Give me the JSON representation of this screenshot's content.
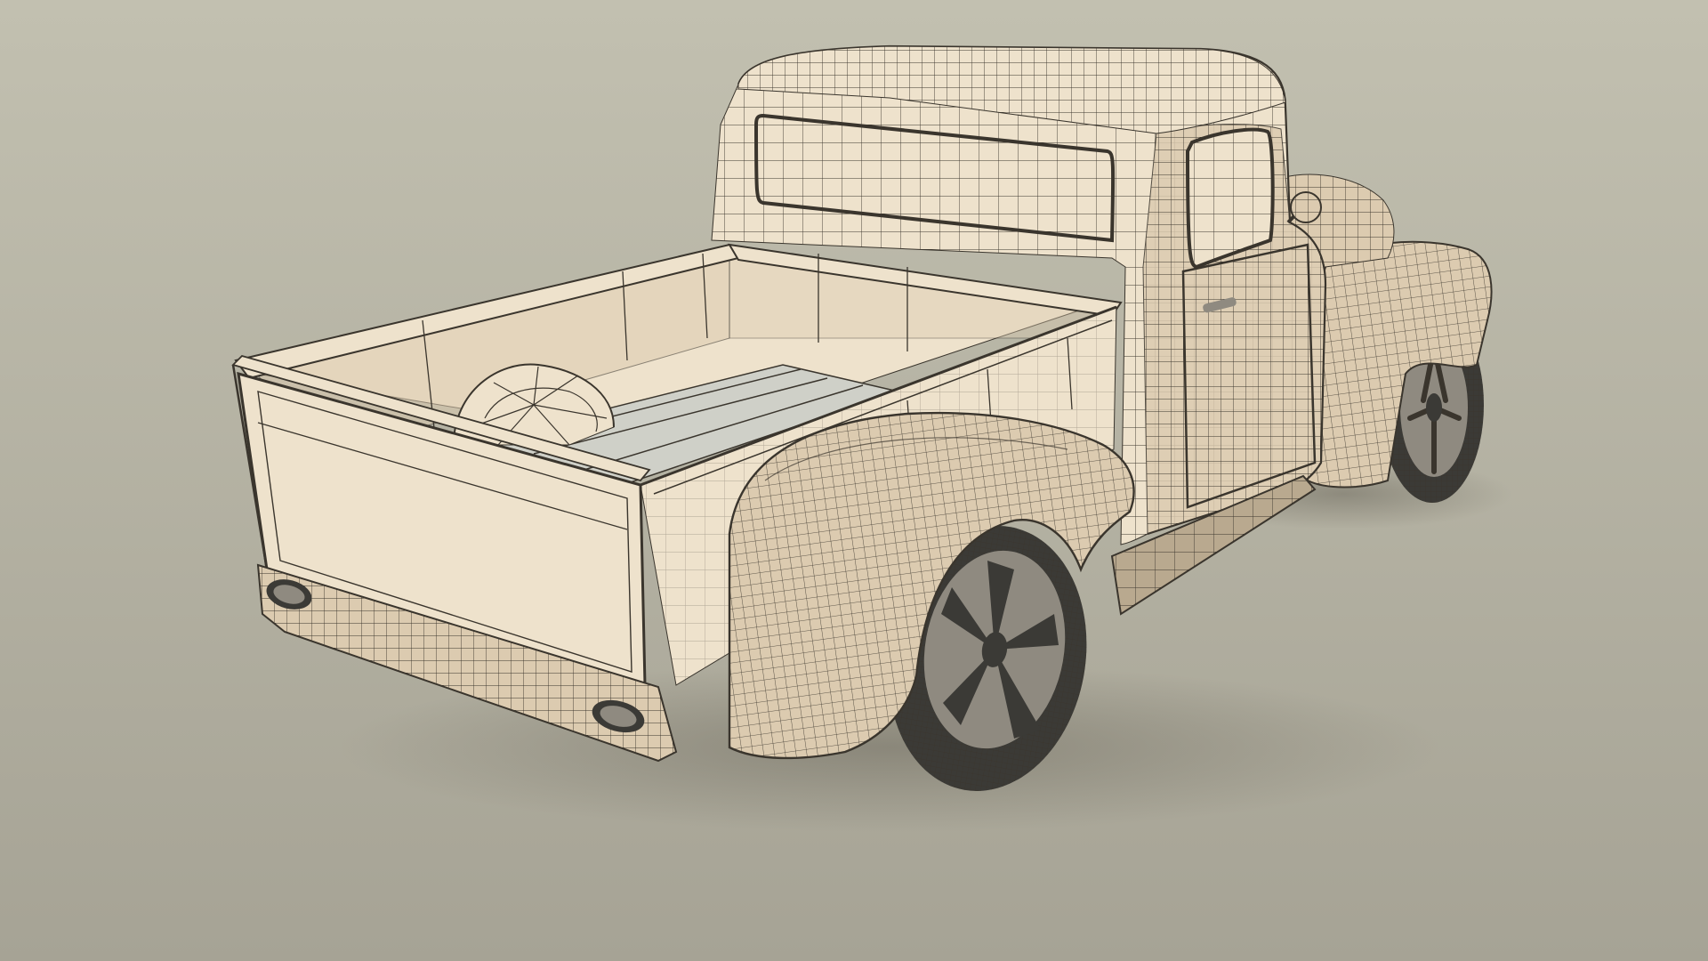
{
  "scene": {
    "subject": "pickup-truck-wireframe-render",
    "colors": {
      "background_top": "#c2c0b0",
      "background_bottom": "#a6a395",
      "shadow": "#6f6b5f",
      "body_light": "#eee2cc",
      "body_mid": "#dccbb0",
      "body_shade": "#b9a98f",
      "wire": "#3a352d",
      "bed_floor": "#cfd0c8",
      "tire": "#3b3a36",
      "rim": "#8f8a80"
    },
    "parts": [
      "cab",
      "rear-window",
      "side-window",
      "roof",
      "cargo-bed",
      "tailgate",
      "spare-tire",
      "rear-fender",
      "front-fender",
      "rear-wheel",
      "front-wheel",
      "running-board",
      "tail-light-left",
      "tail-light-right",
      "door-handle",
      "side-mirror"
    ]
  }
}
